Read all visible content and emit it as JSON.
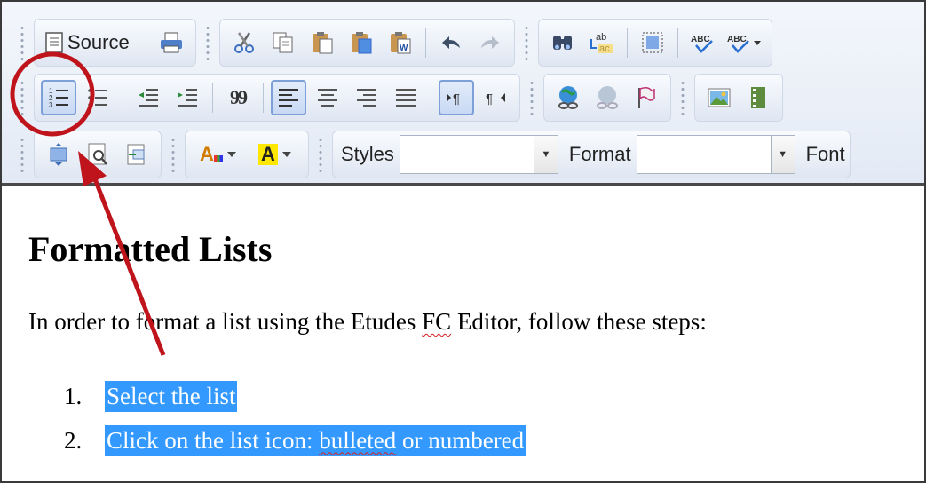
{
  "toolbar": {
    "source_label": "Source",
    "styles_label": "Styles",
    "styles_value": "",
    "format_label": "Format",
    "format_value": "",
    "font_label": "Font",
    "spellcheck_label": "ABC",
    "spellcheck_as_you_type_label": "ABC",
    "text_color_letter": "A",
    "bg_color_letter": "A",
    "blockquote_glyph": "99"
  },
  "colors": {
    "annotation_red": "#c0141c",
    "selection_blue": "#3399ff",
    "toolbar_bg": "#e3eaf5"
  },
  "icons": {
    "row1": [
      "source-icon",
      "print-icon",
      "cut-icon",
      "copy-icon",
      "paste-icon",
      "paste-text-icon",
      "paste-word-icon",
      "undo-icon",
      "redo-icon",
      "find-icon",
      "replace-icon",
      "select-all-icon",
      "spellcheck-icon",
      "spellcheck-as-you-type-icon"
    ],
    "row2": [
      "numbered-list-icon",
      "bulleted-list-icon",
      "outdent-icon",
      "indent-icon",
      "blockquote-icon",
      "align-left-icon",
      "align-center-icon",
      "align-right-icon",
      "justify-icon",
      "ltr-icon",
      "rtl-icon",
      "link-icon",
      "unlink-icon",
      "anchor-icon",
      "image-icon",
      "flash-icon"
    ],
    "row3": [
      "maximize-icon",
      "preview-icon",
      "templates-icon",
      "text-color-icon",
      "bg-color-icon"
    ]
  },
  "document": {
    "heading": "Formatted Lists",
    "intro_before": "In order to format a list using the Etudes ",
    "intro_fc": "FC",
    "intro_after": " Editor, follow these steps:",
    "steps": [
      {
        "number": "1.",
        "text": "Select the list"
      },
      {
        "number": "2.",
        "text_before": "Click on the list icon: ",
        "text_squiggle": "bulleted",
        "text_after": " or numbered"
      }
    ]
  },
  "annotation": {
    "highlight": "circle around numbered-list button",
    "pointer": "arrow pointing to toolbar"
  }
}
